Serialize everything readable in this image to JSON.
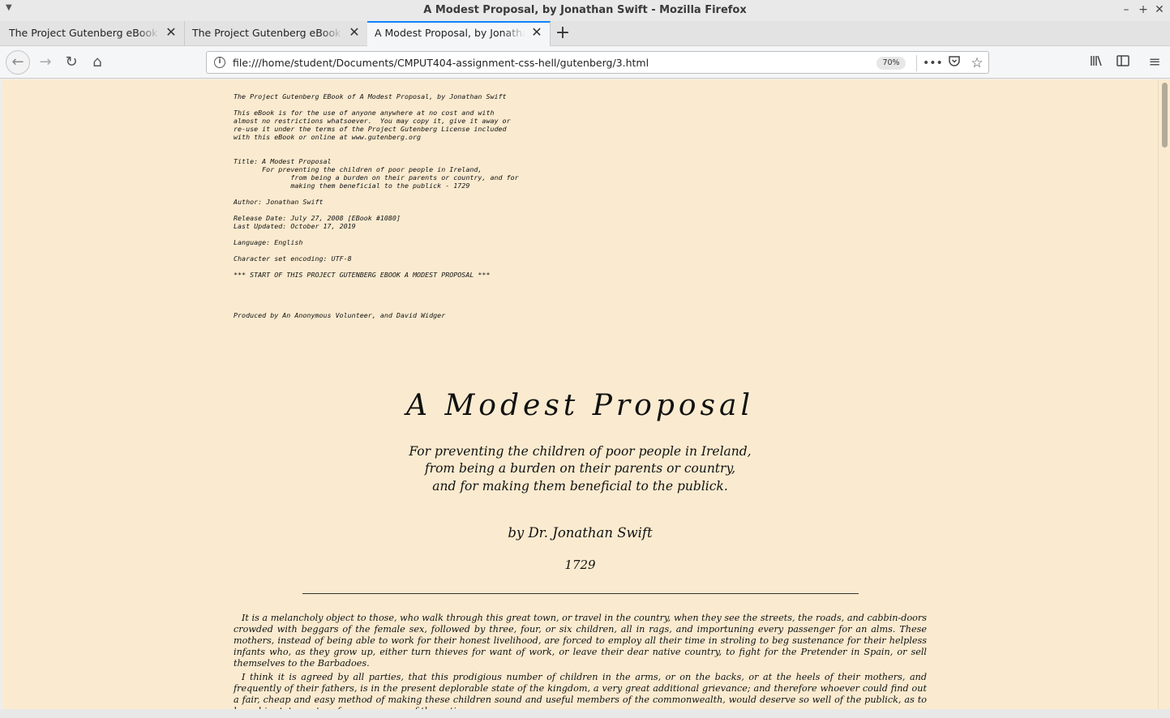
{
  "window": {
    "title": "A Modest Proposal, by Jonathan Swift - Mozilla Firefox"
  },
  "tabs": [
    {
      "label": "The Project Gutenberg eBook of Pride"
    },
    {
      "label": "The Project Gutenberg eBook of Pride"
    },
    {
      "label": "A Modest Proposal, by Jonathan Swift"
    }
  ],
  "navbar": {
    "url": "file:///home/student/Documents/CMPUT404-assignment-css-hell/gutenberg/3.html",
    "zoom": "70%"
  },
  "page": {
    "header_text": "The Project Gutenberg EBook of A Modest Proposal, by Jonathan Swift\n\nThis eBook is for the use of anyone anywhere at no cost and with\nalmost no restrictions whatsoever.  You may copy it, give it away or\nre-use it under the terms of the Project Gutenberg License included\nwith this eBook or online at www.gutenberg.org\n\n\nTitle: A Modest Proposal\n       For preventing the children of poor people in Ireland,\n              from being a burden on their parents or country, and for\n              making them beneficial to the publick - 1729\n\nAuthor: Jonathan Swift\n\nRelease Date: July 27, 2008 [EBook #1080]\nLast Updated: October 17, 2019\n\nLanguage: English\n\nCharacter set encoding: UTF-8\n\n*** START OF THIS PROJECT GUTENBERG EBOOK A MODEST PROPOSAL ***\n\n\n\n\nProduced by An Anonymous Volunteer, and David Widger",
    "title": "A Modest Proposal",
    "subtitle_lines": [
      "For preventing the children of poor people in Ireland,",
      "from being a burden on their parents or country,",
      "and for making them beneficial to the publick."
    ],
    "byline": "by Dr. Jonathan Swift",
    "year": "1729",
    "paragraphs": [
      "It is a melancholy object to those, who walk through this great town, or travel in the country, when they see the streets, the roads, and cabbin-doors crowded with beggars of the female sex, followed by three, four, or six children, all in rags, and importuning every passenger for an alms. These mothers, instead of being able to work for their honest livelihood, are forced to employ all their time in stroling to beg sustenance for their helpless infants who, as they grow up, either turn thieves for want of work, or leave their dear native country, to fight for the Pretender in Spain, or sell themselves to the Barbadoes.",
      "I think it is agreed by all parties, that this prodigious number of children in the arms, or on the backs, or at the heels of their mothers, and frequently of their fathers, is in the present deplorable state of the kingdom, a very great additional grievance; and therefore whoever could find out a fair, cheap and easy method of making these children sound and useful members of the commonwealth, would deserve so well of the publick, as to have his statue set up for a preserver of the nation."
    ]
  }
}
